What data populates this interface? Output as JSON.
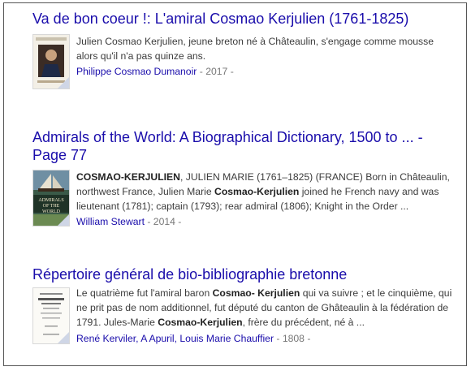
{
  "results": [
    {
      "title": "Va de bon coeur !: L'amiral Cosmao Kerjulien (1761-1825)",
      "snippet_parts": [
        {
          "t": "Julien Cosmao Kerjulien, jeune breton né à Châteaulin, s'engage comme mousse alors qu'il n'a pas quinze ans.",
          "b": false
        }
      ],
      "authors": [
        "Philippe Cosmao Dumanoir"
      ],
      "year": "2017",
      "thumb_icon": "book-cover-portrait-icon"
    },
    {
      "title_line1": "Admirals of the World: A Biographical Dictionary, 1500 to ... -",
      "title_line2": "Page 77",
      "snippet_parts": [
        {
          "t": "COSMAO-KERJULIEN",
          "b": true
        },
        {
          "t": ", JULIEN MARIE (1761–1825) (FRANCE) Born in Châteaulin, northwest France, Julien Marie ",
          "b": false
        },
        {
          "t": "Cosmao-Kerjulien",
          "b": true
        },
        {
          "t": " joined he French navy and was lieutenant (1781); captain (1793); rear admiral (1806); Knight in the Order ...",
          "b": false
        }
      ],
      "authors": [
        "William Stewart"
      ],
      "year": "2014",
      "thumb_icon": "book-cover-ship-icon",
      "thumb_text": "ADMIRALS OF THE WORLD"
    },
    {
      "title": "Répertoire général de bio-bibliographie bretonne",
      "snippet_parts": [
        {
          "t": "Le quatrième fut l'amiral baron ",
          "b": false
        },
        {
          "t": "Cosmao- Kerjulien",
          "b": true
        },
        {
          "t": " qui va suivre ; et le cinquième, qui ne prit pas de nom additionnel, fut député du canton de Ghâteaulin à la fédération de 1791. Jules-Marie ",
          "b": false
        },
        {
          "t": "Cosmao-Kerjulien",
          "b": true
        },
        {
          "t": ", frère du précédent, né à ...",
          "b": false
        }
      ],
      "authors": [
        "René Kerviler",
        "A Apuril",
        "Louis Marie Chauffier"
      ],
      "year": "1808",
      "thumb_icon": "old-book-page-icon"
    }
  ],
  "separator": " - ",
  "author_sep": ", ",
  "colors": {
    "link": "#1a0dab",
    "snippet": "#3c3c3c",
    "meta": "#777777"
  }
}
